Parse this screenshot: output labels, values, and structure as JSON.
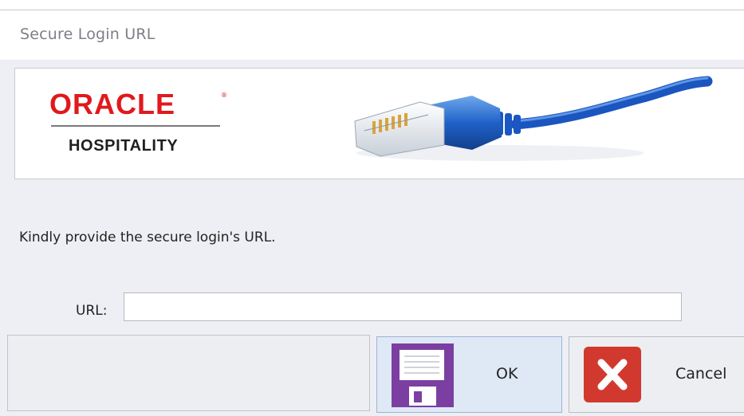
{
  "window": {
    "title": "Secure Login URL"
  },
  "banner": {
    "brand_name": "ORACLE",
    "brand_reg": "®",
    "brand_sub": "HOSPITALITY",
    "image": "ethernet-cable"
  },
  "form": {
    "message": "Kindly provide the secure login's URL.",
    "url_label": "URL:",
    "url_value": "",
    "url_placeholder": ""
  },
  "buttons": {
    "ok_label": "OK",
    "ok_icon": "floppy-disk-icon",
    "cancel_label": "Cancel",
    "cancel_icon": "close-x-icon"
  },
  "colors": {
    "brand_red": "#e0191d",
    "save_purple": "#7b3fa1",
    "cancel_red": "#d2392e"
  }
}
